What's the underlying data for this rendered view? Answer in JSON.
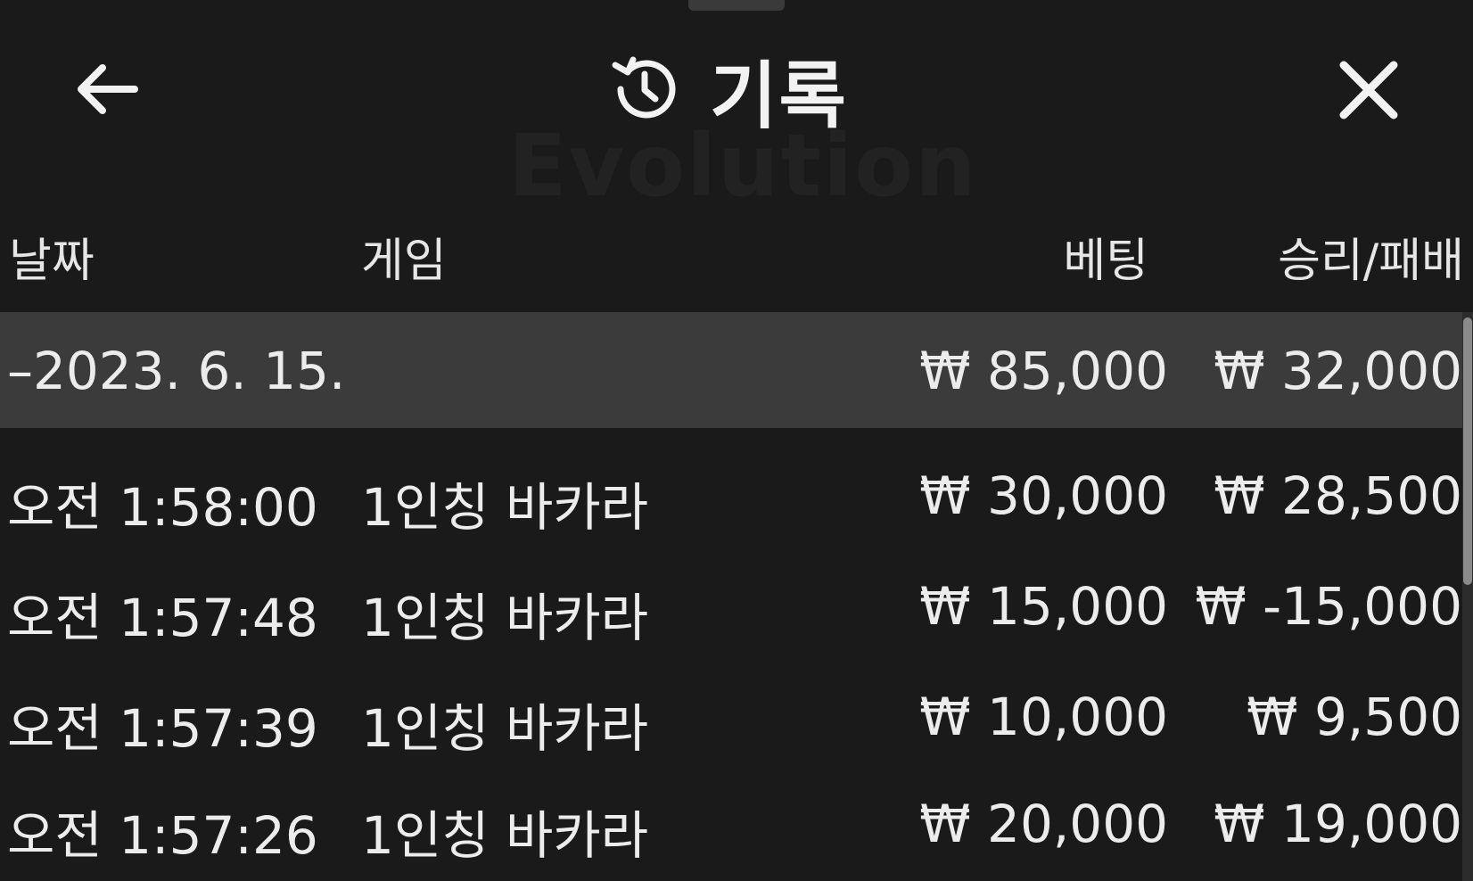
{
  "header": {
    "title": "기록",
    "watermark": "Evolution"
  },
  "columns": {
    "date": "날짜",
    "game": "게임",
    "bet": "베팅",
    "winloss": "승리/패배"
  },
  "summary": {
    "date": "–2023. 6. 15.",
    "bet": "₩ 85,000",
    "winloss": "₩ 32,000"
  },
  "rows": [
    {
      "time": "오전 1:58:00",
      "game": "1인칭 바카라",
      "bet": "₩ 30,000",
      "winloss": "₩ 28,500"
    },
    {
      "time": "오전 1:57:48",
      "game": "1인칭 바카라",
      "bet": "₩ 15,000",
      "winloss": "₩ -15,000"
    },
    {
      "time": "오전 1:57:39",
      "game": "1인칭 바카라",
      "bet": "₩ 10,000",
      "winloss": "₩ 9,500"
    },
    {
      "time": "오전 1:57:26",
      "game": "1인칭 바카라",
      "bet": "₩ 20,000",
      "winloss": "₩ 19,000"
    }
  ],
  "icons": {
    "back": "arrow-left-icon",
    "history": "history-clock-icon",
    "close": "close-icon"
  }
}
